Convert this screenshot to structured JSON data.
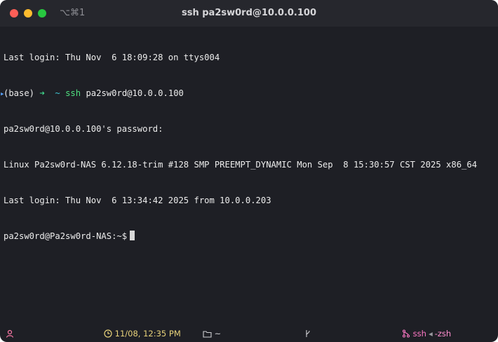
{
  "window": {
    "title": "ssh pa2sw0rd@10.0.0.100",
    "shortcut": "⌥⌘1"
  },
  "terminal": {
    "line1": "Last login: Thu Nov  6 18:09:28 on ttys004",
    "line2_env": "(base)",
    "line2_arrow": "➜",
    "line2_dir": "~",
    "line2_cmd": "ssh",
    "line2_args": "pa2sw0rd@10.0.0.100",
    "line3": "pa2sw0rd@10.0.0.100's password:",
    "line4": "Linux Pa2sw0rd-NAS 6.12.18-trim #128 SMP PREEMPT_DYNAMIC Mon Sep  8 15:30:57 CST 2025 x86_64",
    "line5": "Last login: Thu Nov  6 13:34:42 2025 from 10.0.0.203",
    "prompt": "pa2sw0rd@Pa2sw0rd-NAS:~$"
  },
  "statusbar": {
    "time": "11/08, 12:35 PM",
    "directory": "~",
    "process": "ssh",
    "separator": "◂",
    "shell": "-zsh"
  },
  "colors": {
    "background": "#1e1f25",
    "titlebar": "#26272d",
    "arrow": "#3fd48a",
    "command": "#4fe07f",
    "accent_pink": "#ff79c6",
    "time_yellow": "#e8d27a"
  }
}
